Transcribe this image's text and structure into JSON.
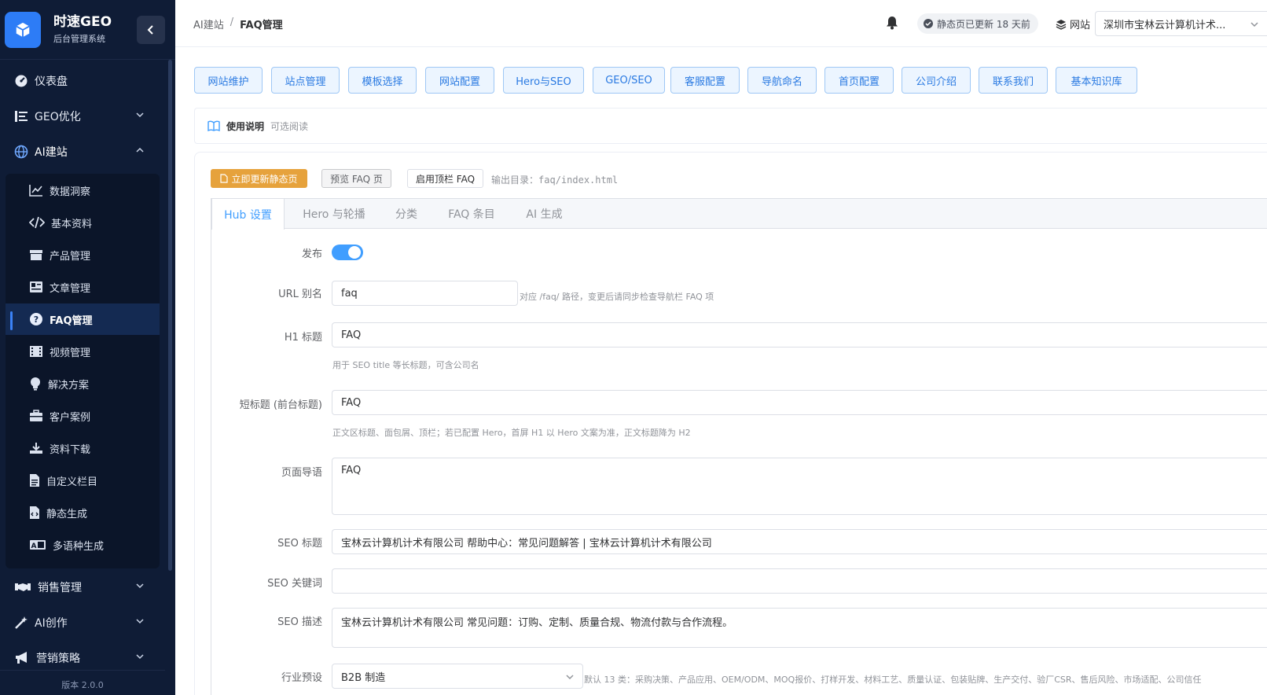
{
  "brand": {
    "title": "时速GEO",
    "subtitle": "后台管理系统"
  },
  "sidebar": {
    "top_items": [
      {
        "label": "仪表盘",
        "icon": "dashboard-icon"
      },
      {
        "label": "GEO优化",
        "icon": "list-icon"
      },
      {
        "label": "AI建站",
        "icon": "globe-icon"
      }
    ],
    "sub_items": [
      {
        "label": "数据洞察",
        "icon": "chart-line-icon"
      },
      {
        "label": "基本资料",
        "icon": "code-icon"
      },
      {
        "label": "产品管理",
        "icon": "box-icon"
      },
      {
        "label": "文章管理",
        "icon": "newspaper-icon"
      },
      {
        "label": "FAQ管理",
        "icon": "question-icon"
      },
      {
        "label": "视频管理",
        "icon": "film-icon"
      },
      {
        "label": "解决方案",
        "icon": "lightbulb-icon"
      },
      {
        "label": "客户案例",
        "icon": "briefcase-icon"
      },
      {
        "label": "资料下载",
        "icon": "download-icon"
      },
      {
        "label": "自定义栏目",
        "icon": "file-icon"
      },
      {
        "label": "静态生成",
        "icon": "file-code-icon"
      },
      {
        "label": "多语种生成",
        "icon": "translate-icon"
      }
    ],
    "bottom_items": [
      {
        "label": "销售管理",
        "icon": "handshake-icon"
      },
      {
        "label": "AI创作",
        "icon": "magic-wand-icon"
      },
      {
        "label": "营销策略",
        "icon": "megaphone-icon"
      }
    ],
    "version": "版本 2.0.0"
  },
  "header": {
    "breadcrumb": [
      "AI建站",
      "/",
      "FAQ管理"
    ],
    "status": "静态页已更新 18 天前",
    "site_label": "网站",
    "site_value": "深圳市宝林云计算机计术..."
  },
  "top_tabs": [
    "网站维护",
    "站点管理",
    "模板选择",
    "网站配置",
    "Hero与SEO",
    "GEO/SEO",
    "客服配置",
    "导航命名",
    "首页配置",
    "公司介绍",
    "联系我们",
    "基本知识库"
  ],
  "notice": {
    "title": "使用说明",
    "sub": "可选阅读"
  },
  "actions": {
    "update": "立即更新静态页",
    "preview": "预览 FAQ 页",
    "enable_nav": "启用顶栏 FAQ",
    "output_label": "输出目录：",
    "output_path": "faq/index.html"
  },
  "tabs": [
    "Hub 设置",
    "Hero 与轮播",
    "分类",
    "FAQ 条目",
    "AI 生成"
  ],
  "form": {
    "publish": {
      "label": "发布",
      "value": true
    },
    "slug": {
      "label": "URL 别名",
      "value": "faq",
      "hint": "对应 /faq/ 路径，变更后请同步检查导航栏 FAQ 项"
    },
    "h1": {
      "label": "H1 标题",
      "value": "FAQ",
      "hint": "用于 SEO title 等长标题，可含公司名"
    },
    "short_title": {
      "label": "短标题 (前台标题)",
      "value": "FAQ",
      "hint": "正文区标题、面包屑、顶栏；若已配置 Hero，首屏 H1 以 Hero 文案为准，正文标题降为 H2"
    },
    "intro": {
      "label": "页面导语",
      "value": "FAQ"
    },
    "seo_title": {
      "label": "SEO 标题",
      "value": "宝林云计算机计术有限公司 帮助中心：常见问题解答 | 宝林云计算机计术有限公司"
    },
    "seo_keywords": {
      "label": "SEO 关键词",
      "value": ""
    },
    "seo_desc": {
      "label": "SEO 描述",
      "value": "宝林云计算机计术有限公司 常见问题：订购、定制、质量合规、物流付款与合作流程。"
    },
    "industry": {
      "label": "行业预设",
      "value": "B2B 制造",
      "hint": "默认 13 类：采购决策、产品应用、OEM/ODM、MOQ报价、打样开发、材料工艺、质量认证、包装贴牌、生产交付、验厂CSR、售后风险、市场适配、公司信任"
    }
  },
  "colors": {
    "accent": "#409eff",
    "sidebar_bg": "#0f1c36",
    "warning": "#e6a23c"
  }
}
